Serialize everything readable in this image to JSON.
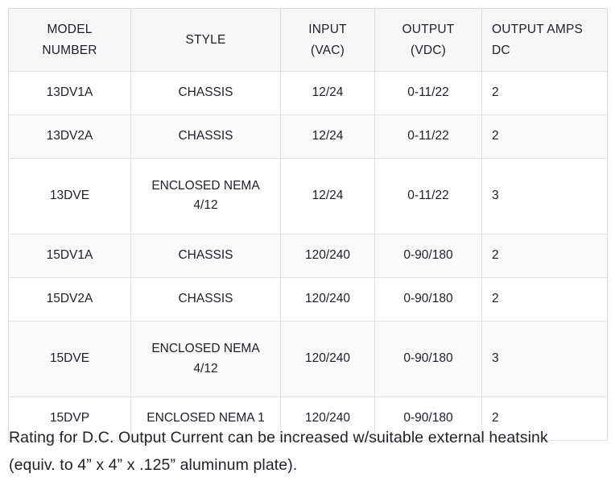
{
  "table": {
    "columns": [
      {
        "label": "MODEL\nNUMBER",
        "line1": "MODEL",
        "line2": "NUMBER",
        "align": "center"
      },
      {
        "label": "STYLE",
        "line1": "STYLE",
        "line2": "",
        "align": "center"
      },
      {
        "label": "INPUT\n(VAC)",
        "line1": "INPUT",
        "line2": "(VAC)",
        "align": "center"
      },
      {
        "label": "OUTPUT\n(VDC)",
        "line1": "OUTPUT",
        "line2": "(VDC)",
        "align": "center"
      },
      {
        "label": "OUTPUT AMPS\nDC",
        "line1": "OUTPUT AMPS",
        "line2": "DC",
        "align": "left"
      }
    ],
    "rows": [
      {
        "model_number": "13DV1A",
        "style_line1": "CHASSIS",
        "style_line2": "",
        "input_vac": "12/24",
        "output_vdc": "0-11/22",
        "output_amps_dc": "2",
        "shaded": false,
        "tall": false
      },
      {
        "model_number": "13DV2A",
        "style_line1": "CHASSIS",
        "style_line2": "",
        "input_vac": "12/24",
        "output_vdc": "0-11/22",
        "output_amps_dc": "2",
        "shaded": true,
        "tall": false
      },
      {
        "model_number": "13DVE",
        "style_line1": "ENCLOSED NEMA",
        "style_line2": "4/12",
        "input_vac": "12/24",
        "output_vdc": "0-11/22",
        "output_amps_dc": "3",
        "shaded": false,
        "tall": true
      },
      {
        "model_number": "15DV1A",
        "style_line1": "CHASSIS",
        "style_line2": "",
        "input_vac": "120/240",
        "output_vdc": "0-90/180",
        "output_amps_dc": "2",
        "shaded": true,
        "tall": false
      },
      {
        "model_number": "15DV2A",
        "style_line1": "CHASSIS",
        "style_line2": "",
        "input_vac": "120/240",
        "output_vdc": "0-90/180",
        "output_amps_dc": "2",
        "shaded": false,
        "tall": false
      },
      {
        "model_number": "15DVE",
        "style_line1": "ENCLOSED NEMA",
        "style_line2": "4/12",
        "input_vac": "120/240",
        "output_vdc": "0-90/180",
        "output_amps_dc": "3",
        "shaded": true,
        "tall": true
      },
      {
        "model_number": "15DVP",
        "style_line1": "ENCLOSED NEMA 1",
        "style_line2": "",
        "input_vac": "120/240",
        "output_vdc": "0-90/180",
        "output_amps_dc": "2",
        "shaded": false,
        "tall": false
      }
    ]
  },
  "footnote": {
    "text": "Rating for D.C. Output Current can be increased w/suitable external heatsink (equiv. to 4” x 4” x .125” aluminum plate)."
  },
  "colors": {
    "header_background": "#f7f7f7",
    "row_shaded_background": "#fafafa",
    "row_plain_background": "#ffffff",
    "border": "#dcdcdc",
    "text": "#1e1e2d"
  }
}
